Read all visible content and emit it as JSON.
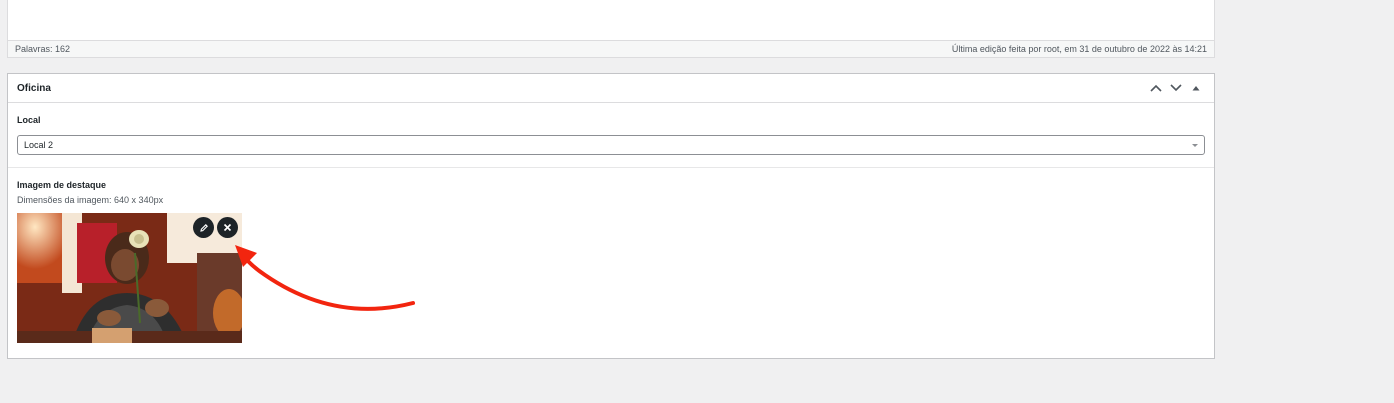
{
  "status_bar": {
    "word_count": "Palavras: 162",
    "last_edit": "Última edição feita por root, em 31 de outubro de 2022 às 14:21"
  },
  "metabox": {
    "title": "Oficina",
    "icons": [
      "chevron-up-icon",
      "chevron-down-icon",
      "collapse-triangle-icon"
    ],
    "local_field": {
      "label": "Local",
      "selected": "Local 2"
    },
    "image_field": {
      "label": "Imagem de destaque",
      "description": "Dimensões da imagem: 640 x 340px",
      "actions": [
        "edit-pencil-icon",
        "remove-x-icon"
      ]
    }
  },
  "colors": {
    "background": "#f0f0f1",
    "panel": "#ffffff",
    "border": "#c3c4c7",
    "action_button": "#1d2327",
    "annotation_arrow": "#f2250f"
  }
}
